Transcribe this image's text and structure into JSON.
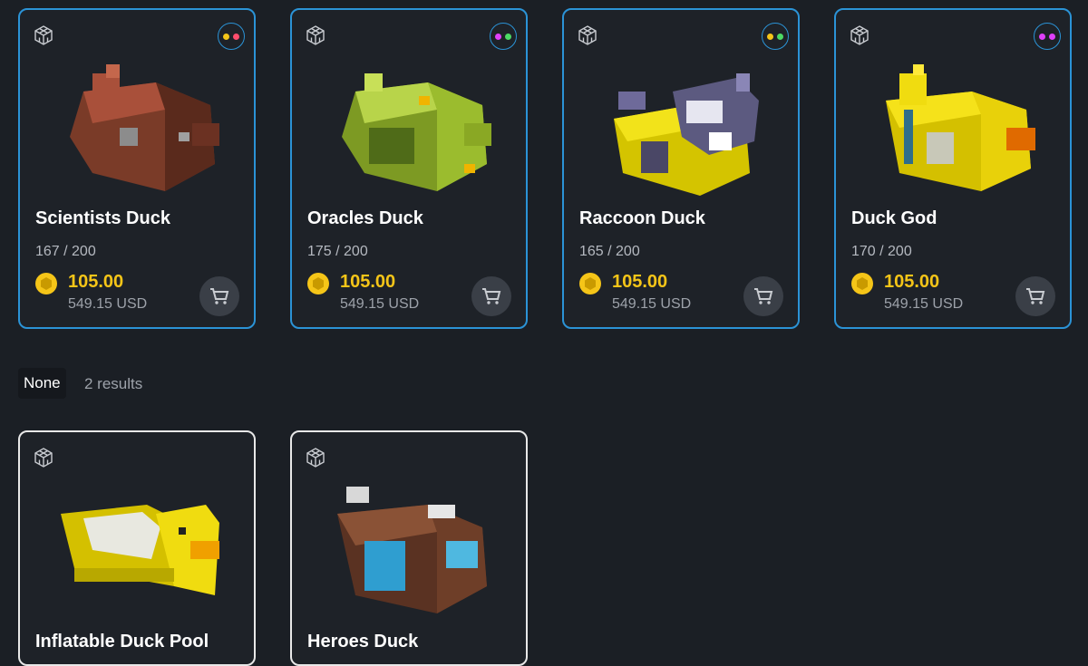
{
  "colors": {
    "accent_border": "#2b93d6",
    "price": "#f5c518",
    "background": "#1b1f25"
  },
  "cards": [
    {
      "title": "Scientists Duck",
      "supply": "167 / 200",
      "price": "105.00",
      "usd": "549.15 USD",
      "dots": [
        "#f5c518",
        "#ff4d6d"
      ]
    },
    {
      "title": "Oracles Duck",
      "supply": "175 / 200",
      "price": "105.00",
      "usd": "549.15 USD",
      "dots": [
        "#e040fb",
        "#4cd964"
      ]
    },
    {
      "title": "Raccoon Duck",
      "supply": "165 / 200",
      "price": "105.00",
      "usd": "549.15 USD",
      "dots": [
        "#f5c518",
        "#4cd964"
      ]
    },
    {
      "title": "Duck God",
      "supply": "170 / 200",
      "price": "105.00",
      "usd": "549.15 USD",
      "dots": [
        "#e040fb",
        "#e040fb"
      ]
    }
  ],
  "group": {
    "label": "None",
    "count": "2 results"
  },
  "cards2": [
    {
      "title": "Inflatable Duck Pool"
    },
    {
      "title": "Heroes Duck"
    }
  ],
  "icons": {
    "cube": "cube-3d-icon",
    "coin": "coin-icon",
    "cart": "cart-icon"
  }
}
